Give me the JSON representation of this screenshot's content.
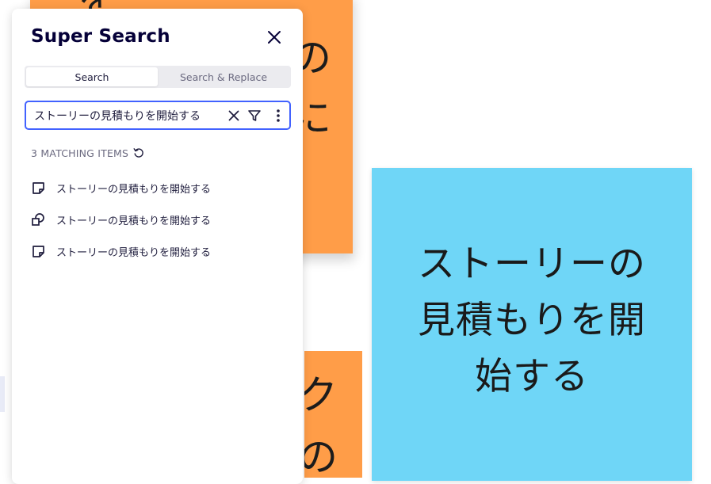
{
  "panel": {
    "title": "Super Search",
    "tabs": [
      {
        "label": "Search",
        "active": true
      },
      {
        "label": "Search & Replace",
        "active": false
      }
    ],
    "search": {
      "value": "ストーリーの見積もりを開始する",
      "clear_icon": "close-icon",
      "filter_icon": "filter-icon",
      "more_icon": "more-vertical-icon"
    },
    "matching_label": "3 MATCHING ITEMS",
    "results": [
      {
        "icon": "sticky-note-icon",
        "label": "ストーリーの見積もりを開始する"
      },
      {
        "icon": "shapes-icon",
        "label": "ストーリーの見積もりを開始する"
      },
      {
        "icon": "sticky-note-icon",
        "label": "ストーリーの見積もりを開始する"
      }
    ],
    "accent_color": "#4262ff"
  },
  "canvas": {
    "blue_note": {
      "lines": [
        "ストーリーの",
        "見積もりを開",
        "始する"
      ],
      "color": "#6fd6f7"
    },
    "orange_top_partial": [
      "を",
      "の",
      "に"
    ],
    "orange_bottom_partial": [
      "ク",
      "の"
    ],
    "orange_color": "#ff9d48"
  }
}
